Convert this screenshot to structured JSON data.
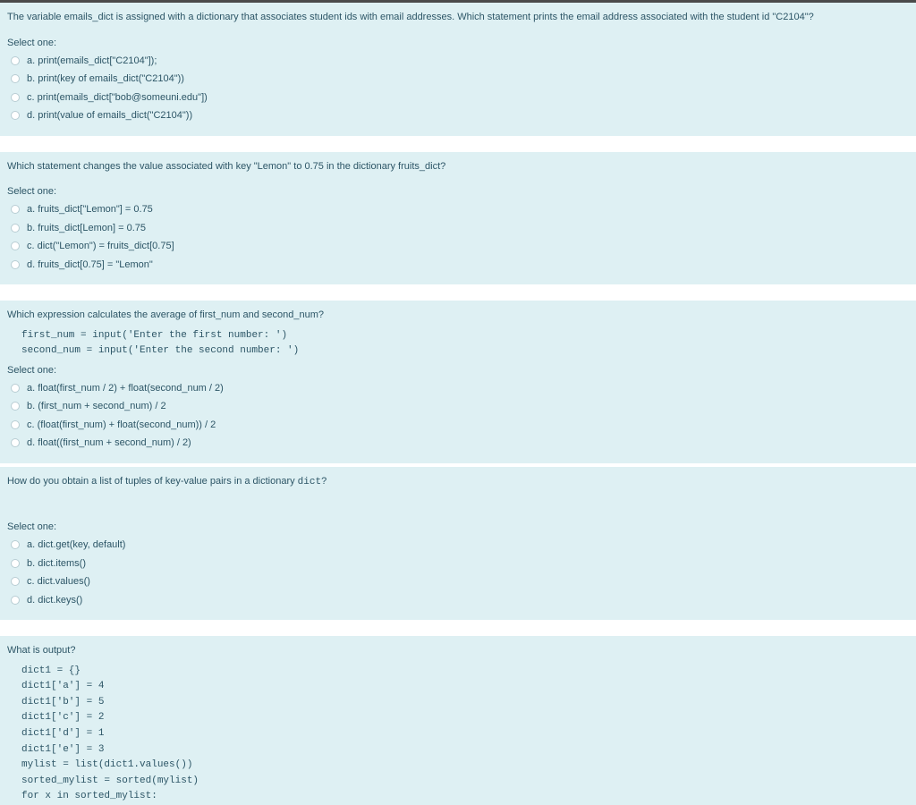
{
  "selectone_label": "Select one:",
  "questions": [
    {
      "prompt": "The variable emails_dict is assigned with a dictionary that associates student ids with email addresses. Which statement prints the email address associated with the student id \"C2104\"?",
      "options": [
        "a. print(emails_dict[\"C2104\"]);",
        "b. print(key of emails_dict(\"C2104\"))",
        "c. print(emails_dict[\"bob@someuni.edu\"])",
        "d. print(value of emails_dict(\"C2104\"))"
      ]
    },
    {
      "prompt": "Which statement changes the value associated with key \"Lemon\" to 0.75 in the dictionary fruits_dict?",
      "options": [
        "a. fruits_dict[\"Lemon\"] = 0.75",
        "b. fruits_dict[Lemon] = 0.75",
        "c. dict(\"Lemon\") = fruits_dict[0.75]",
        "d. fruits_dict[0.75] = \"Lemon\""
      ]
    },
    {
      "prompt": "Which expression calculates the average of first_num and second_num?",
      "code": "first_num = input('Enter the first number: ')\nsecond_num = input('Enter the second number: ')",
      "options": [
        "a. float(first_num / 2) + float(second_num / 2)",
        "b. (first_num + second_num) / 2",
        "c. (float(first_num) + float(second_num)) / 2",
        "d. float((first_num + second_num) / 2)"
      ]
    },
    {
      "prompt_html": "How do you obtain a list of tuples of key-value pairs in a dictionary <span class=\"mono-inline\">dict</span>?",
      "extra_space": true,
      "options": [
        "a. dict.get(key, default)",
        "b. dict.items()",
        "c. dict.values()",
        "d. dict.keys()"
      ]
    },
    {
      "prompt": "What is output?",
      "code": "dict1 = {}\ndict1['a'] = 4\ndict1['b'] = 5\ndict1['c'] = 2\ndict1['d'] = 1\ndict1['e'] = 3\nmylist = list(dict1.values())\nsorted_mylist = sorted(mylist)\nfor x in sorted_mylist:",
      "truncated": true
    }
  ]
}
